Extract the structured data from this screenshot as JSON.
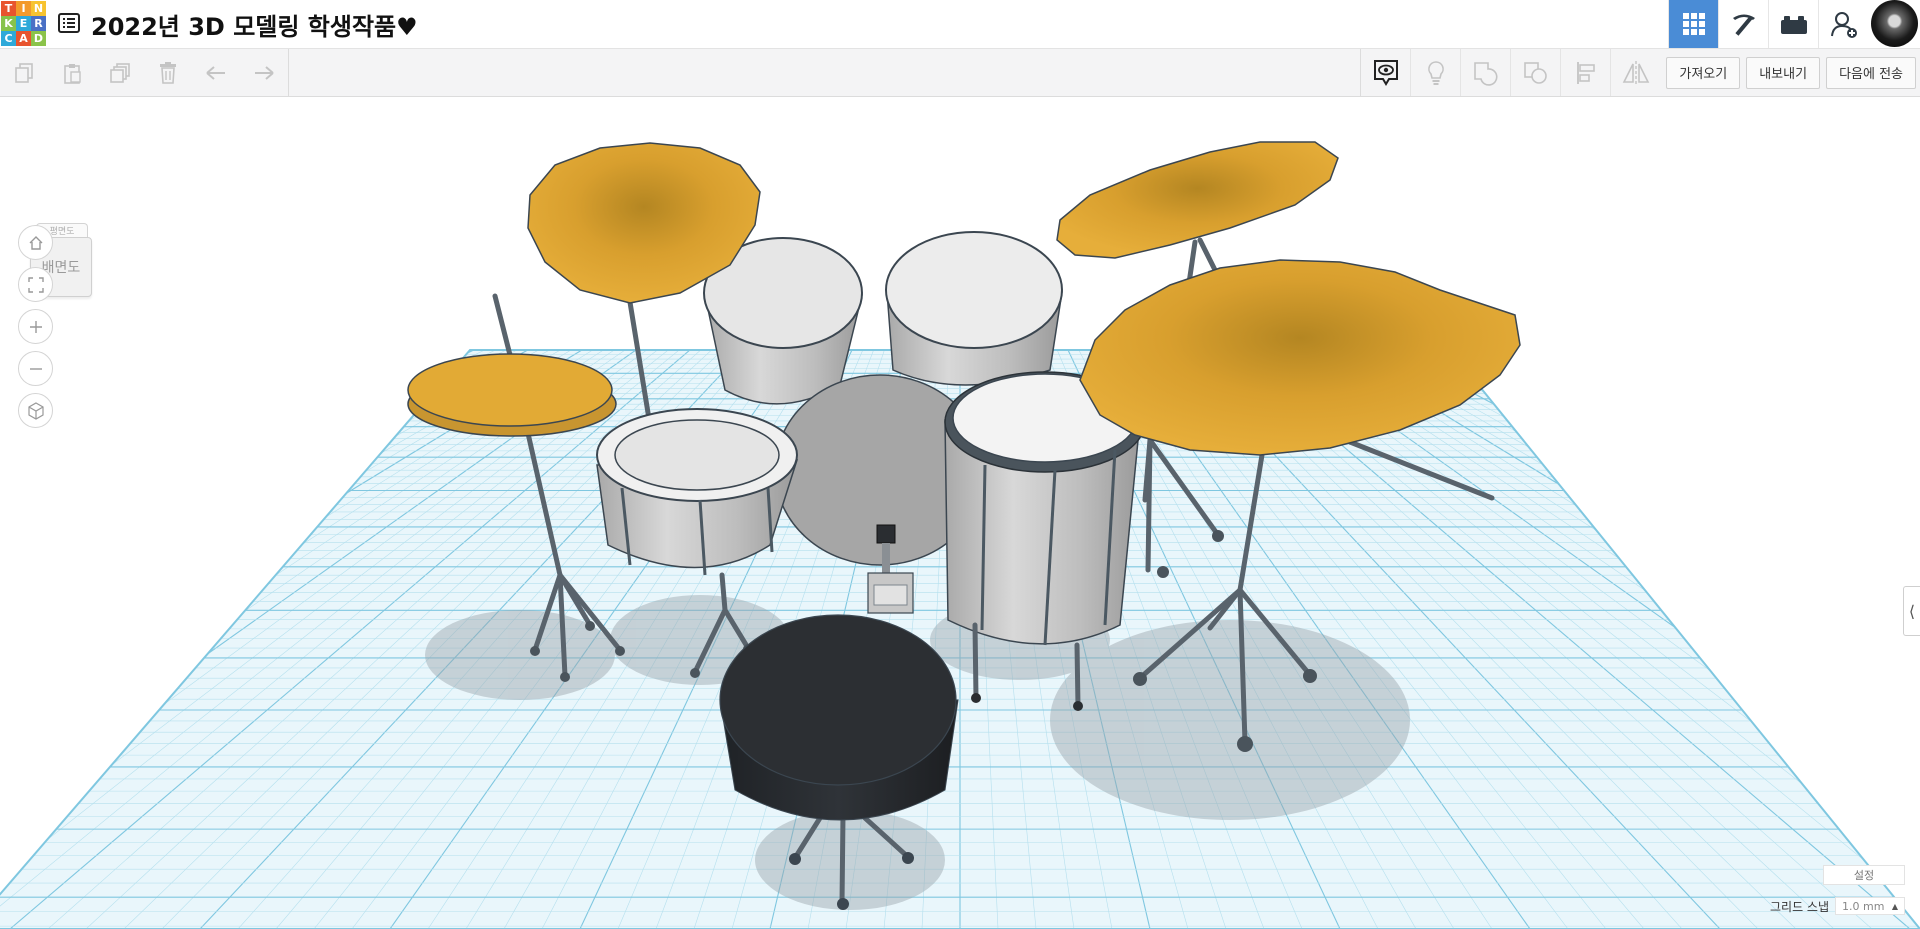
{
  "app": {
    "logo_letters": [
      "T",
      "I",
      "N",
      "K",
      "E",
      "R",
      "C",
      "A",
      "D"
    ],
    "logo_colors": [
      "#e8542e",
      "#f39a2b",
      "#f7c330",
      "#87c34a",
      "#2ea9d9",
      "#4a70c5",
      "#2ea9d9",
      "#e8542e",
      "#8bc34a"
    ]
  },
  "header": {
    "title": "2022년 3D 모델링 학생작품♥",
    "title_icon": "list-icon",
    "right_icons": [
      "grid-view-icon",
      "pickaxe-icon",
      "bricks-icon",
      "add-user-icon"
    ],
    "active_color": "#4a8cd6"
  },
  "toolbar": {
    "left_icons": [
      "copy-icon",
      "paste-icon",
      "duplicate-icon",
      "delete-icon",
      "undo-icon",
      "redo-icon"
    ],
    "right_icons": [
      "notes-visibility-icon",
      "light-bulb-icon",
      "group-icon",
      "ungroup-icon",
      "align-icon",
      "mirror-icon"
    ],
    "import_label": "가져오기",
    "export_label": "내보내기",
    "send_label": "다음에 전송"
  },
  "viewcube": {
    "front_label": "배면도",
    "top_label": "평면도"
  },
  "nav_controls": [
    "home-view-icon",
    "fit-all-icon",
    "zoom-in-icon",
    "zoom-out-icon",
    "perspective-icon"
  ],
  "workplane": {
    "settings_label": "설정",
    "grid_snap_label": "그리드 스냅",
    "grid_snap_value": "1.0 mm",
    "grid_color": "#7fc7e0",
    "cymbal_color": "#dda532",
    "drum_shell_color": "#c7c7c7",
    "seat_color": "#2a2d31"
  },
  "side_panel": {
    "collapse_glyph": "⟨"
  }
}
